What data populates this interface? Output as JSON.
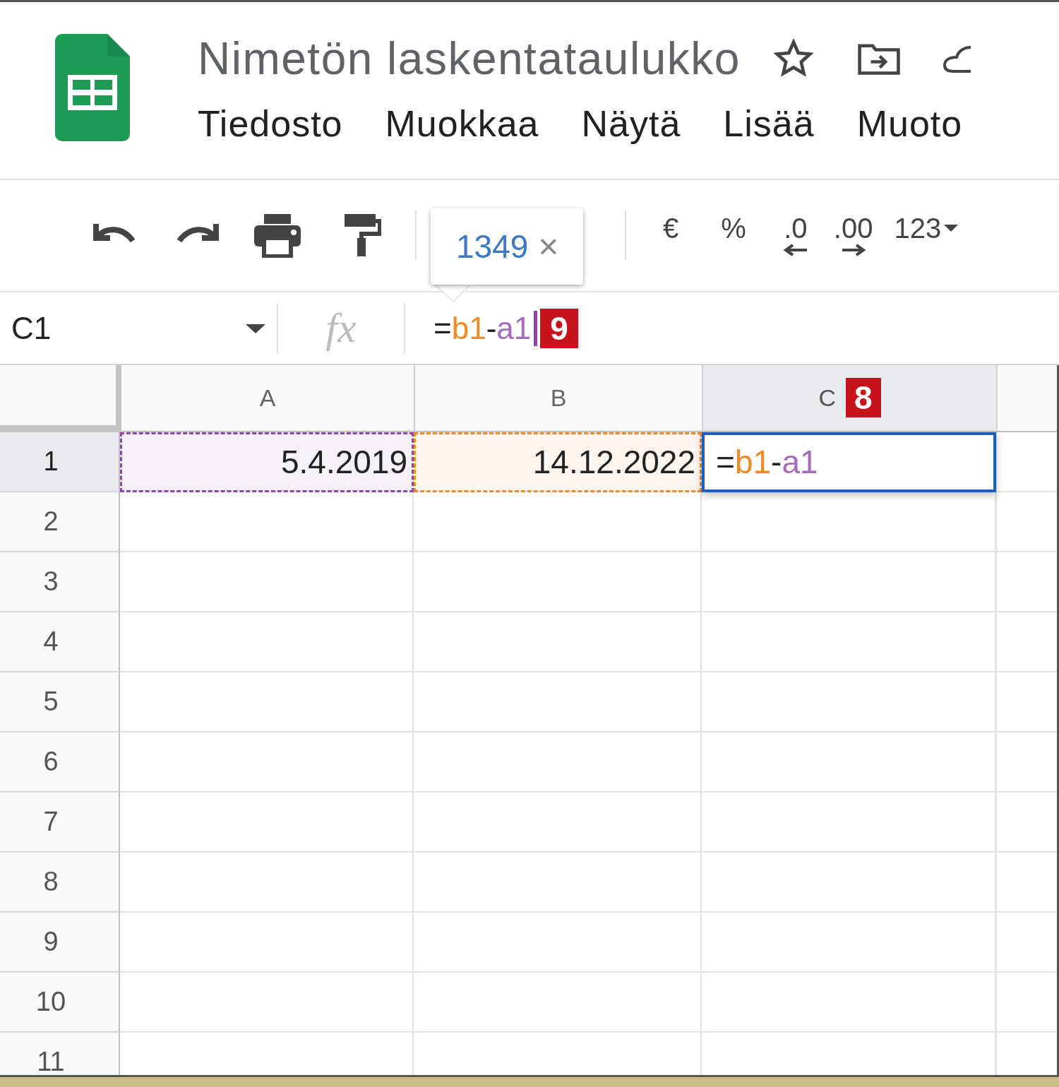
{
  "header": {
    "title": "Nimetön laskentataulukko",
    "menu": [
      "Tiedosto",
      "Muokkaa",
      "Näytä",
      "Lisää",
      "Muoto"
    ]
  },
  "toolbar": {
    "tooltip": {
      "value": "1349",
      "close": "×"
    },
    "format_buttons": [
      {
        "label": "€",
        "kind": "plain"
      },
      {
        "label": "%",
        "kind": "plain"
      },
      {
        "label": ".0",
        "kind": "decrease"
      },
      {
        "label": ".00",
        "kind": "increase"
      },
      {
        "label": "123",
        "kind": "dropdown"
      }
    ]
  },
  "formula_bar": {
    "cell_ref": "C1",
    "fx": "fx",
    "formula": [
      {
        "text": "=",
        "color": "#222222"
      },
      {
        "text": "b1",
        "color": "#f08a24"
      },
      {
        "text": "-",
        "color": "#222222"
      },
      {
        "text": "a1",
        "color": "#a569bd"
      }
    ],
    "badge": "9"
  },
  "grid": {
    "columns": [
      {
        "label": "A",
        "selected": false
      },
      {
        "label": "B",
        "selected": false
      },
      {
        "label": "C",
        "selected": true,
        "badge": "8"
      }
    ],
    "rows": [
      {
        "label": "1",
        "selected": true,
        "cells": [
          {
            "kind": "value",
            "value": "5.4.2019",
            "color": "#8e44ad",
            "selected": false
          },
          {
            "kind": "value",
            "value": "14.12.2022",
            "color": "#f08a24",
            "selected": false
          },
          {
            "kind": "formula",
            "tokens": [
              {
                "text": "=",
                "color": "#222222"
              },
              {
                "text": "b1",
                "color": "#f08a24"
              },
              {
                "text": "-",
                "color": "#222222"
              },
              {
                "text": "a1",
                "color": "#a569bd"
              }
            ],
            "selected": true
          }
        ]
      },
      {
        "label": "2",
        "selected": false
      },
      {
        "label": "3",
        "selected": false
      },
      {
        "label": "4",
        "selected": false
      },
      {
        "label": "5",
        "selected": false
      },
      {
        "label": "6",
        "selected": false
      },
      {
        "label": "7",
        "selected": false
      },
      {
        "label": "8",
        "selected": false
      },
      {
        "label": "9",
        "selected": false
      },
      {
        "label": "10",
        "selected": false
      },
      {
        "label": "11",
        "selected": false
      }
    ]
  }
}
